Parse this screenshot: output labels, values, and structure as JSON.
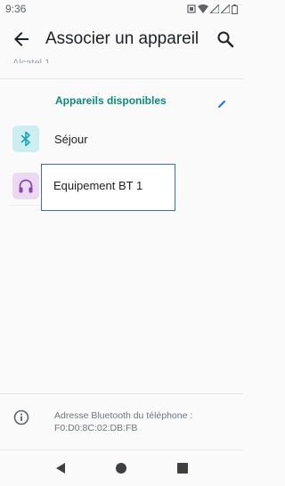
{
  "status": {
    "time": "9:36"
  },
  "app_bar": {
    "title": "Associer un appareil"
  },
  "faded_item": "Alcatel 1",
  "section": {
    "header": "Appareils disponibles"
  },
  "devices": [
    {
      "label": "Séjour",
      "icon": "bluetooth-icon",
      "icon_bg": "#cdeef1",
      "icon_color": "#1aa3b5"
    },
    {
      "label": "Equipement  BT  1",
      "icon": "headset-icon",
      "icon_bg": "#ead9f0",
      "icon_color": "#8e44ad"
    }
  ],
  "footer": {
    "address_label": "Adresse Bluetooth du téléphone :",
    "address_value": "F0:D0:8C:02:DB:FB"
  },
  "colors": {
    "accent": "#0d8a7a",
    "selection": "#3d6db0"
  }
}
